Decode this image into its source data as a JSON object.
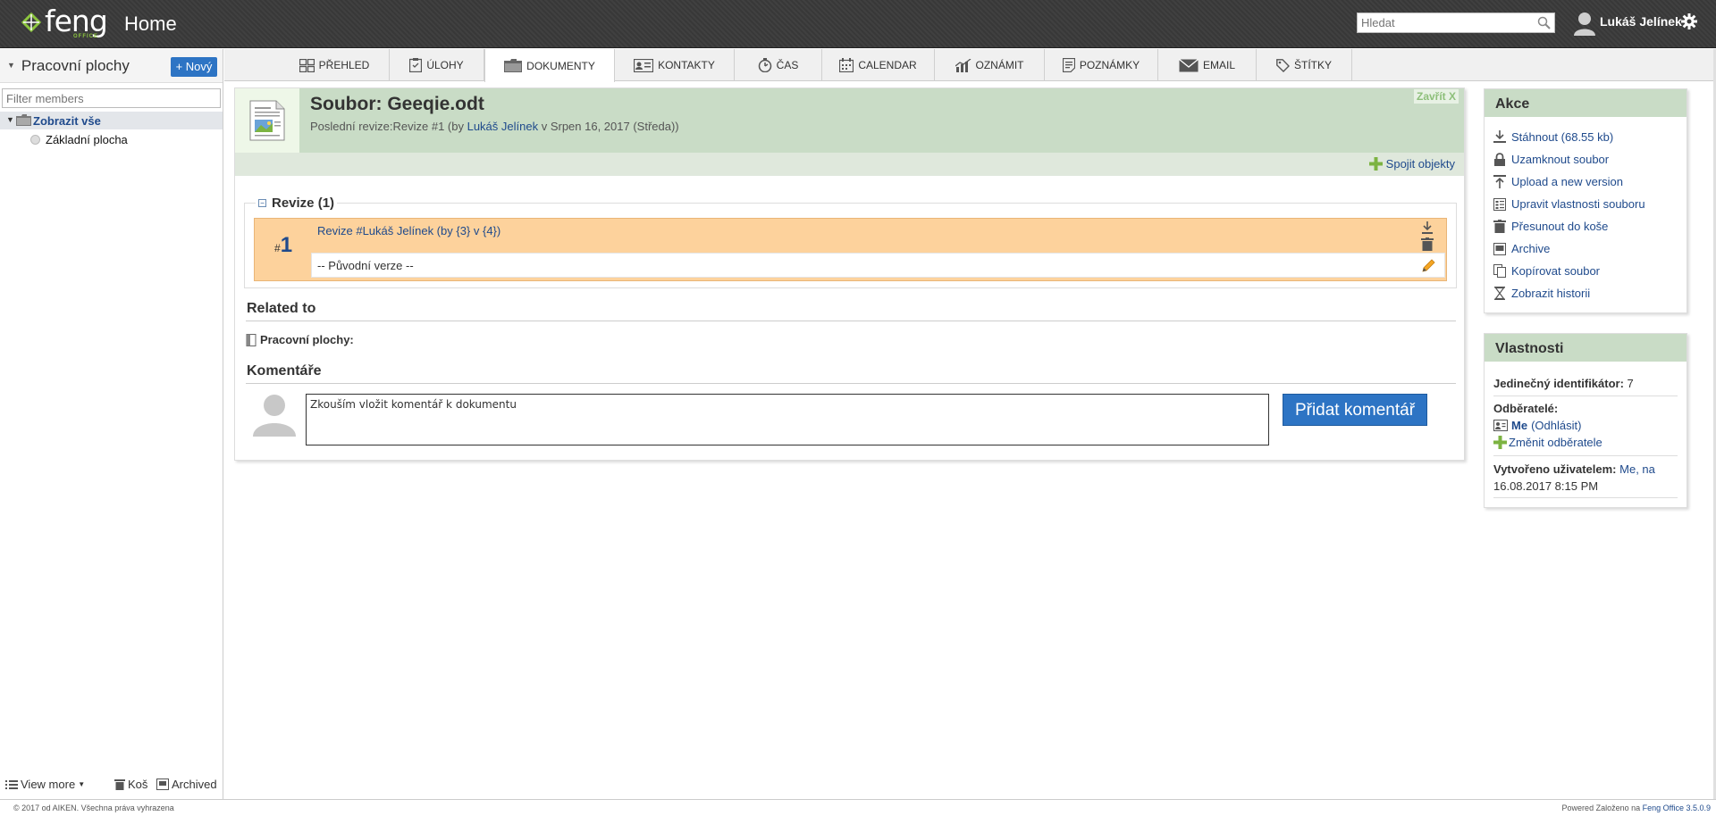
{
  "header": {
    "logo_text": "feng",
    "logo_sub": "OFFICE",
    "page_title": "Home",
    "search_placeholder": "Hledat",
    "user_name": "Lukáš Jelínek"
  },
  "sidebar": {
    "title": "Pracovní plochy",
    "new_button": "+ Nový",
    "filter_placeholder": "Filter members",
    "tree_root": "Zobrazit vše",
    "tree_child": "Základní plocha",
    "footer": {
      "view_more": "View more",
      "trash": "Koš",
      "archived": "Archived"
    }
  },
  "tabs": [
    {
      "label": "PŘEHLED",
      "icon": "overview-icon"
    },
    {
      "label": "ÚLOHY",
      "icon": "tasks-icon"
    },
    {
      "label": "DOKUMENTY",
      "icon": "folder-icon",
      "active": true
    },
    {
      "label": "KONTAKTY",
      "icon": "contacts-icon"
    },
    {
      "label": "ČAS",
      "icon": "time-icon"
    },
    {
      "label": "CALENDAR",
      "icon": "calendar-icon"
    },
    {
      "label": "OZNÁMIT",
      "icon": "reports-icon"
    },
    {
      "label": "POZNÁMKY",
      "icon": "notes-icon"
    },
    {
      "label": "EMAIL",
      "icon": "email-icon"
    },
    {
      "label": "ŠTÍTKY",
      "icon": "tag-icon"
    }
  ],
  "document": {
    "title": "Soubor: Geeqie.odt",
    "sub_prefix": "Poslední revize:Revize #1 (by ",
    "sub_author": "Lukáš Jelínek",
    "sub_suffix": " v Srpen 16, 2017 (Středa))",
    "close_label": "Zavřít X",
    "connect_label": "Spojit objekty",
    "revisions": {
      "legend": "Revize (1)",
      "hash": "#",
      "number": "1",
      "title": "Revize #Lukáš Jelínek (by {3} v {4})",
      "comment": "-- Původní verze --"
    },
    "related_title": "Related to",
    "related_workspaces": "Pracovní plochy:",
    "comments_title": "Komentáře",
    "comment_value": "Zkouším vložit komentář k dokumentu",
    "add_comment_button": "Přidat komentář"
  },
  "actions": {
    "title": "Akce",
    "items": [
      {
        "label": "Stáhnout (68.55 kb)",
        "icon": "download-icon"
      },
      {
        "label": "Uzamknout soubor",
        "icon": "lock-icon"
      },
      {
        "label": "Upload a new version",
        "icon": "upload-icon"
      },
      {
        "label": "Upravit vlastnosti souboru",
        "icon": "properties-icon"
      },
      {
        "label": "Přesunout do koše",
        "icon": "trash-icon"
      },
      {
        "label": "Archive",
        "icon": "archive-icon"
      },
      {
        "label": "Kopírovat soubor",
        "icon": "copy-icon"
      },
      {
        "label": "Zobrazit historii",
        "icon": "history-icon"
      }
    ]
  },
  "properties": {
    "title": "Vlastnosti",
    "unique_id_label": "Jedinečný identifikátor:",
    "unique_id_value": "7",
    "subscribers_label": "Odběratelé:",
    "subscriber_me": "Me",
    "unsubscribe": "(Odhlásit)",
    "change_subscribers": "Změnit odběratele",
    "created_by_label": "Vytvořeno uživatelem:",
    "created_by_value": "Me, na",
    "created_date": "16.08.2017 8:15 PM"
  },
  "footer": {
    "copyright": "© 2017 od AIKEN. Všechna práva vyhrazena",
    "powered_prefix": "Powered Založeno na ",
    "powered_link": "Feng Office 3.5.0.9"
  },
  "colors": {
    "brand_green": "#8dc63f",
    "header_dark": "#3a3a3a",
    "primary_blue": "#2d74c4",
    "link_blue": "#1f4a8c",
    "panel_green": "#c9dcc6",
    "revision_orange": "#fdd29c"
  }
}
